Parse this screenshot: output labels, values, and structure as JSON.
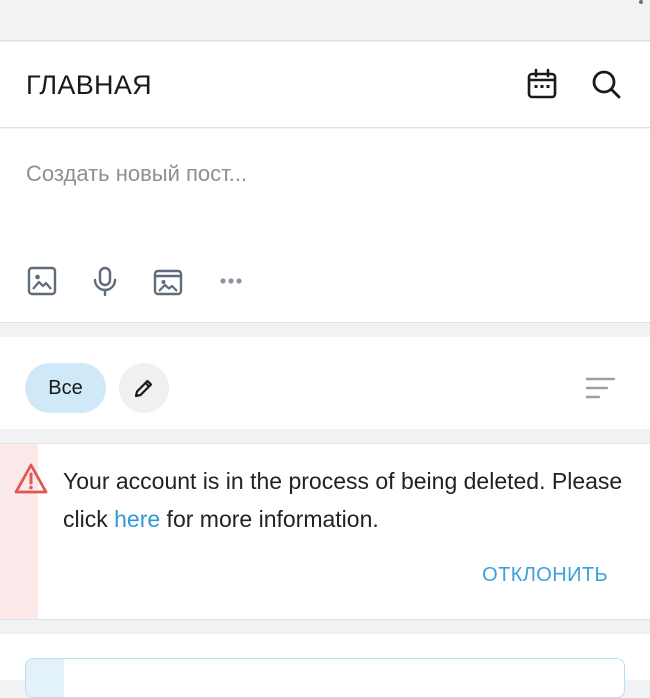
{
  "header": {
    "title": "ГЛАВНАЯ",
    "icons": [
      "calendar-icon",
      "search-icon"
    ]
  },
  "composer": {
    "placeholder": "Создать новый пост...",
    "tools": [
      "image-icon",
      "microphone-icon",
      "gallery-icon",
      "more-icon"
    ]
  },
  "filters": {
    "all_label": "Все",
    "icons": [
      "pencil-icon",
      "sort-icon"
    ]
  },
  "alert": {
    "message_before": "Your account is in the process of being deleted. Please click ",
    "link_text": "here",
    "message_after": " for more information.",
    "dismiss_label": "ОТКЛОНИТЬ",
    "icon": "warning-icon",
    "colors": {
      "stripe": "#fbe9e9",
      "warning": "#e0574f",
      "link": "#2f9ad6"
    }
  },
  "colors": {
    "accent": "#3aa1dc",
    "chip_active": "#cfe9f8"
  }
}
